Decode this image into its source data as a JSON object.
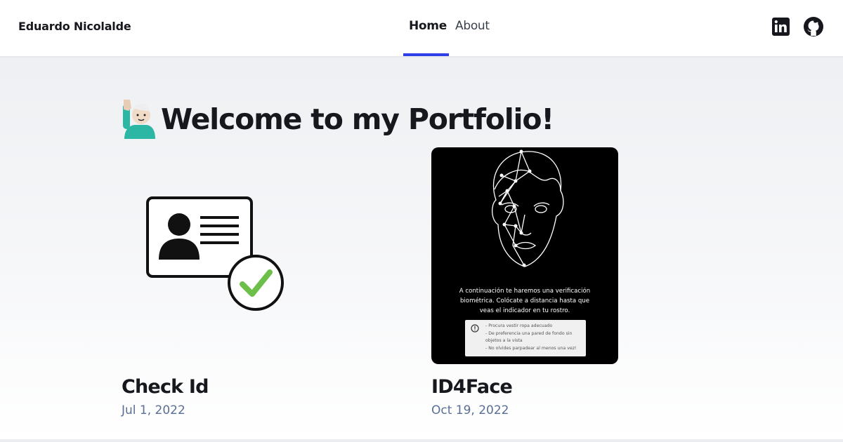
{
  "header": {
    "brand": "Eduardo Nicolalde",
    "nav": {
      "home_label": "Home",
      "about_label": "About",
      "active": "Home"
    },
    "social": [
      {
        "icon": "linkedin-icon"
      },
      {
        "icon": "github-icon"
      }
    ]
  },
  "main": {
    "heading_emoji_icon": "person-raising-hand-emoji-icon",
    "heading": "Welcome to my Portfolio!",
    "projects": [
      {
        "title": "Check Id",
        "date": "Jul 1, 2022",
        "thumbnail_icon": "id-card-check-icon"
      },
      {
        "title": "ID4Face",
        "date": "Oct 19, 2022",
        "thumbnail_icon": "face-mesh-icon",
        "thumbnail_text": {
          "line1": "A continuación te haremos una verificación",
          "line2": "biométrica. Colócate a distancia hasta que",
          "line3": "veas el indicador en tu rostro.",
          "tips": [
            "- Procura vestir ropa adecuado",
            "- De preferencia una pared de fondo sin",
            "objetos a la vista",
            "- No olvides parpadear al menos una vez!"
          ]
        }
      }
    ]
  },
  "colors": {
    "accent": "#2f3fe8",
    "date_text": "#5a6f95",
    "check_green": "#6cc04a"
  }
}
